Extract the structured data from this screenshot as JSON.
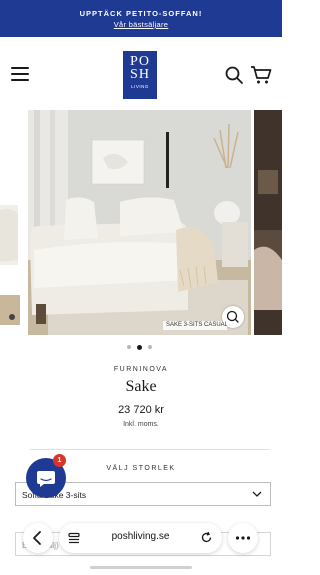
{
  "promo": {
    "title": "UPPTÄCK PETITO-SOFFAN!",
    "link": "Vår bästsäljare",
    "color": "#1f3a93"
  },
  "header": {
    "logo_line1": "PO",
    "logo_line2": "SH",
    "logo_sub": "LIVING",
    "icons": [
      "menu-icon",
      "search-icon",
      "cart-icon"
    ]
  },
  "gallery": {
    "caption": "SAKE 3-SITS CASUAL",
    "slide_count": 3,
    "active_slide": 2
  },
  "product": {
    "brand": "FURNINOVA",
    "title": "Sake",
    "price": "23 720 kr",
    "vat_note": "Inkl. moms."
  },
  "options": {
    "size_label": "VÄLJ STORLEK",
    "size_value": "Soffa Sake 3-sits",
    "second_value": "Bl... (Välj)"
  },
  "chat": {
    "badge": "1"
  },
  "browser": {
    "url": "poshliving.se"
  }
}
